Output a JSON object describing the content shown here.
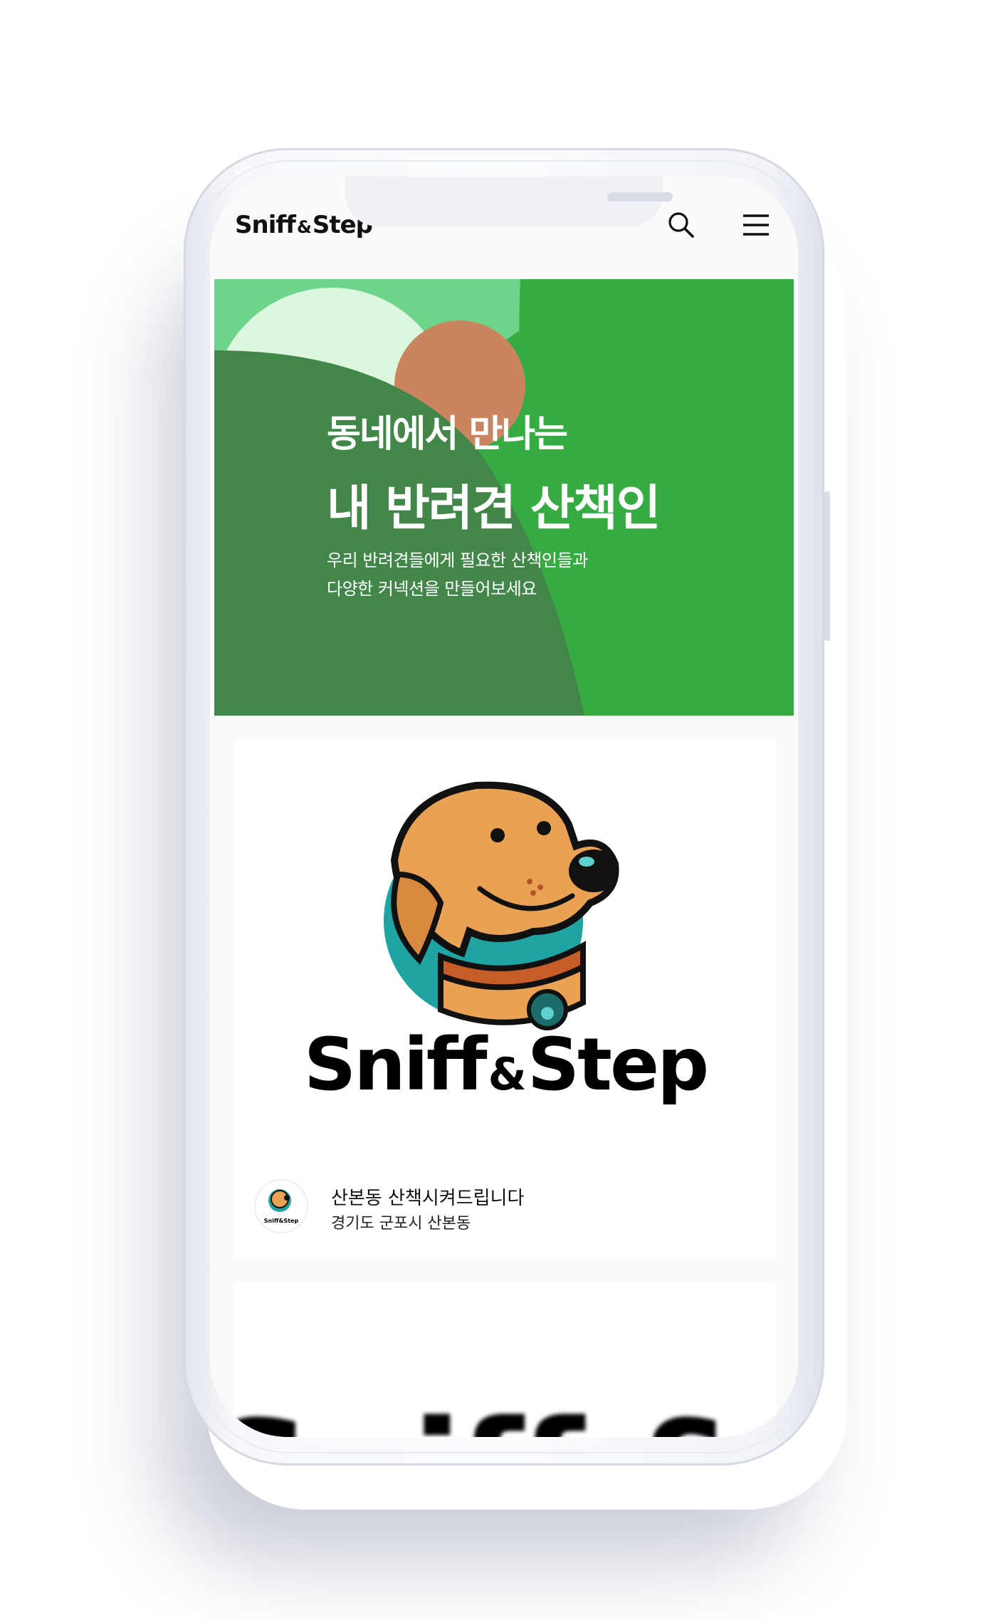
{
  "header": {
    "logo_left": "Sniff",
    "logo_amp": "&",
    "logo_right": "Step",
    "search_icon": "search-icon",
    "menu_icon": "hamburger-menu-icon"
  },
  "hero": {
    "line1": "동네에서 만나는",
    "line2": "내 반려견 산책인",
    "sub1": "우리 반려견들에게 필요한 산책인들과",
    "sub2": "다양한 커넥션을 만들어보세요",
    "colors": {
      "light_green": "#6dd48c",
      "mid_green": "#36ab42",
      "dark_green": "#43864a",
      "sun": "#c8855f",
      "pale": "#dcf7de"
    }
  },
  "posts": [
    {
      "image_brand_left": "Sniff",
      "image_brand_amp": "&",
      "image_brand_right": "Step",
      "avatar_label": "Sniff&Step",
      "title": "산본동 산책시켜드립니다",
      "location": "경기도 군포시 산본동"
    },
    {
      "image_brand_partial": "Sniff & St"
    }
  ]
}
